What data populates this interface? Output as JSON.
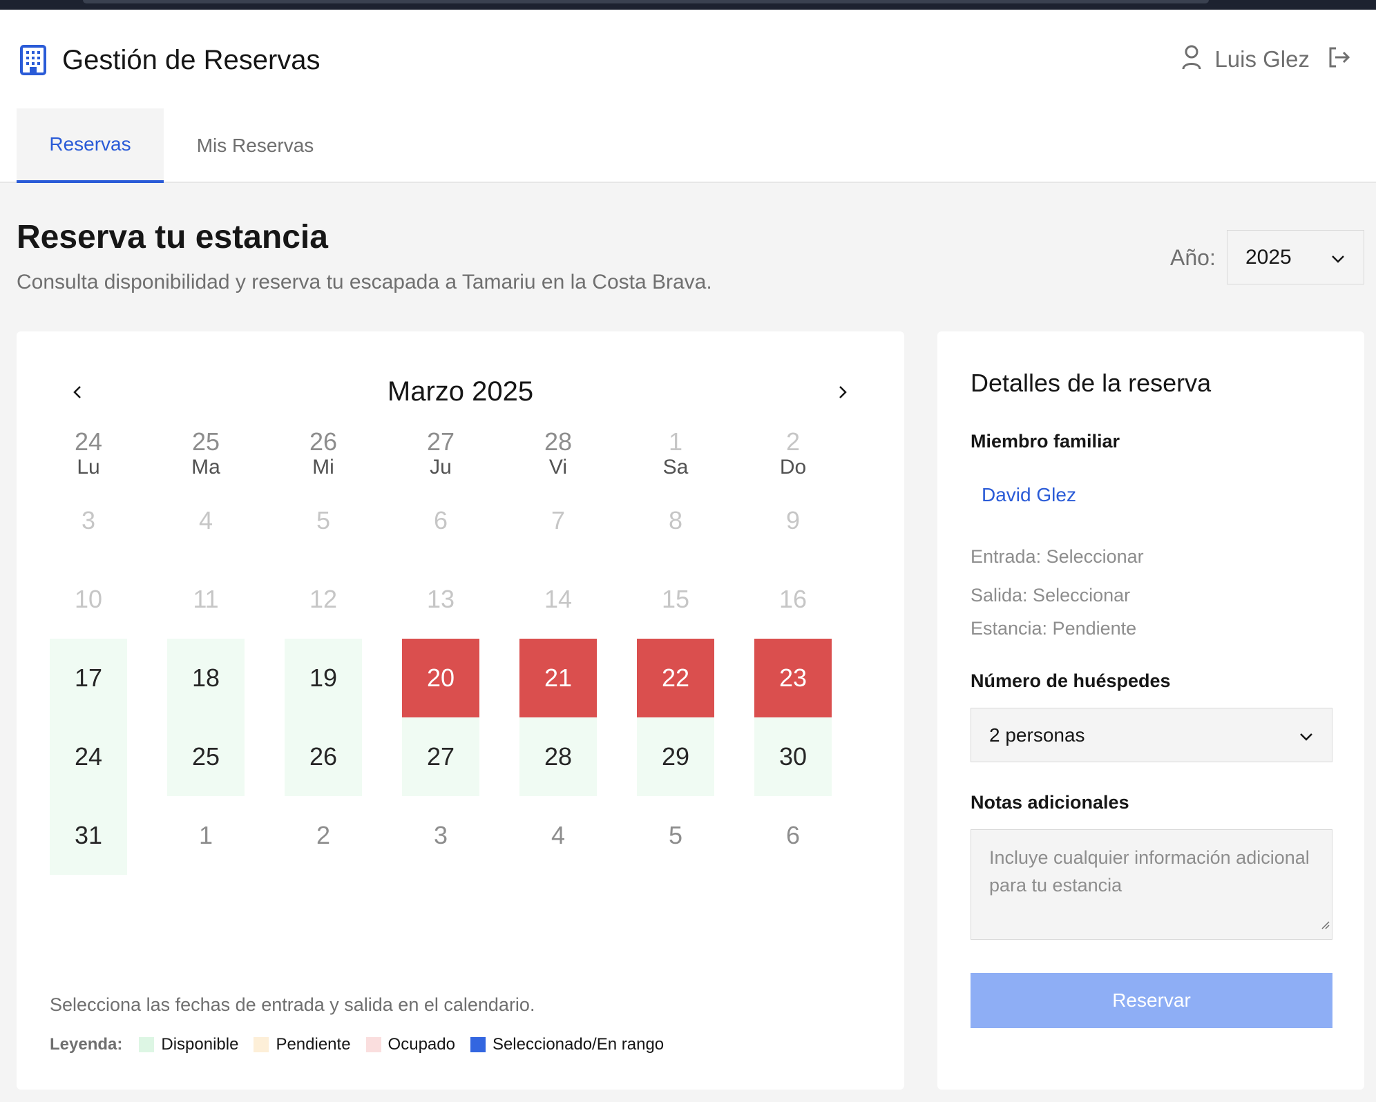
{
  "header": {
    "app_title": "Gestión de Reservas",
    "logo_icon": "building-icon",
    "user_name": "Luis Glez",
    "user_icon": "user-icon",
    "logout_icon": "logout-icon"
  },
  "tabs": [
    {
      "label": "Reservas",
      "active": true
    },
    {
      "label": "Mis Reservas",
      "active": false
    }
  ],
  "page": {
    "title": "Reserva tu estancia",
    "subtitle": "Consulta disponibilidad y reserva tu escapada a Tamariu en la Costa Brava.",
    "year_label": "Año:",
    "year_value": "2025"
  },
  "calendar": {
    "month_title": "Marzo 2025",
    "prev_icon": "chevron-left-icon",
    "next_icon": "chevron-right-icon",
    "weekdays": [
      "Lu",
      "Ma",
      "Mi",
      "Ju",
      "Vi",
      "Sa",
      "Do"
    ],
    "weeks": [
      [
        {
          "d": "24",
          "s": "other"
        },
        {
          "d": "25",
          "s": "other"
        },
        {
          "d": "26",
          "s": "other"
        },
        {
          "d": "27",
          "s": "other"
        },
        {
          "d": "28",
          "s": "other"
        },
        {
          "d": "1",
          "s": "past"
        },
        {
          "d": "2",
          "s": "past"
        }
      ],
      [
        {
          "d": "3",
          "s": "past"
        },
        {
          "d": "4",
          "s": "past"
        },
        {
          "d": "5",
          "s": "past"
        },
        {
          "d": "6",
          "s": "past"
        },
        {
          "d": "7",
          "s": "past"
        },
        {
          "d": "8",
          "s": "past"
        },
        {
          "d": "9",
          "s": "past"
        }
      ],
      [
        {
          "d": "10",
          "s": "past"
        },
        {
          "d": "11",
          "s": "past"
        },
        {
          "d": "12",
          "s": "past"
        },
        {
          "d": "13",
          "s": "past"
        },
        {
          "d": "14",
          "s": "past"
        },
        {
          "d": "15",
          "s": "past"
        },
        {
          "d": "16",
          "s": "past"
        }
      ],
      [
        {
          "d": "17",
          "s": "avail"
        },
        {
          "d": "18",
          "s": "avail"
        },
        {
          "d": "19",
          "s": "avail"
        },
        {
          "d": "20",
          "s": "booked"
        },
        {
          "d": "21",
          "s": "booked"
        },
        {
          "d": "22",
          "s": "booked"
        },
        {
          "d": "23",
          "s": "booked"
        }
      ],
      [
        {
          "d": "24",
          "s": "avail"
        },
        {
          "d": "25",
          "s": "avail"
        },
        {
          "d": "26",
          "s": "avail"
        },
        {
          "d": "27",
          "s": "avail"
        },
        {
          "d": "28",
          "s": "avail"
        },
        {
          "d": "29",
          "s": "avail"
        },
        {
          "d": "30",
          "s": "avail"
        }
      ],
      [
        {
          "d": "31",
          "s": "avail"
        },
        {
          "d": "1",
          "s": "other"
        },
        {
          "d": "2",
          "s": "other"
        },
        {
          "d": "3",
          "s": "other"
        },
        {
          "d": "4",
          "s": "other"
        },
        {
          "d": "5",
          "s": "other"
        },
        {
          "d": "6",
          "s": "other"
        }
      ]
    ],
    "hint": "Selecciona las fechas de entrada y salida en el calendario.",
    "legend_title": "Leyenda:",
    "legend": [
      {
        "label": "Disponible",
        "color": "#ddf6e4"
      },
      {
        "label": "Pendiente",
        "color": "#fdefd8"
      },
      {
        "label": "Ocupado",
        "color": "#fadede"
      },
      {
        "label": "Seleccionado/En rango",
        "color": "#3366e0"
      }
    ]
  },
  "details": {
    "title": "Detalles de la reserva",
    "member_label": "Miembro familiar",
    "member_value": "David Glez",
    "entrada": "Entrada: Seleccionar",
    "salida": "Salida: Seleccionar",
    "estancia": "Estancia: Pendiente",
    "guests_label": "Número de huéspedes",
    "guests_value": "2 personas",
    "notes_label": "Notas adicionales",
    "notes_placeholder": "Incluye cualquier información adicional para tu estancia",
    "submit_label": "Reservar"
  },
  "colors": {
    "accent": "#2a5bd7",
    "booked": "#da4f4e",
    "available": "#f0fbf3",
    "button_disabled": "#8eaef5"
  }
}
